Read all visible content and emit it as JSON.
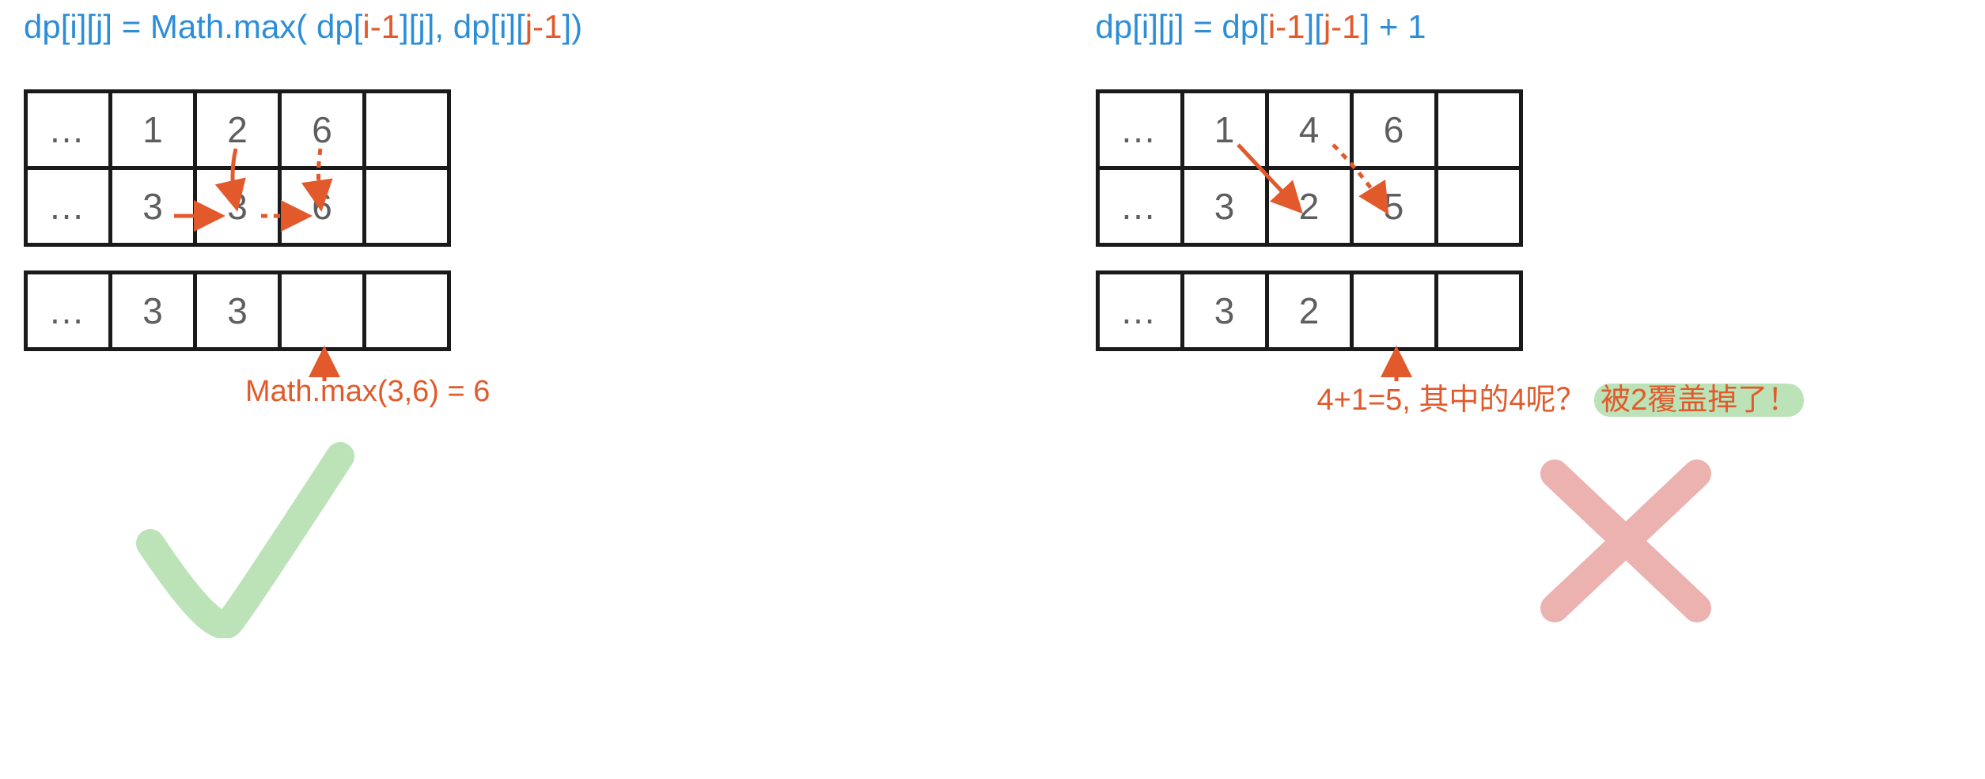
{
  "left": {
    "formula": {
      "p1": "dp[i][j] = Math.max( dp[",
      "r1": "i-1",
      "p2": "][j], dp[i][",
      "r2": "j-1",
      "p3": "])"
    },
    "grid_top": [
      [
        "…",
        "1",
        "2",
        "6",
        ""
      ],
      [
        "…",
        "3",
        "3",
        "6",
        ""
      ]
    ],
    "grid_bottom": [
      [
        "…",
        "3",
        "3",
        "",
        ""
      ]
    ],
    "explain": "Math.max(3,6) = 6",
    "mark": "check"
  },
  "right": {
    "formula": {
      "p1": "dp[i][j] = dp[",
      "r1": "i-1",
      "p2": "][",
      "r2": "j-1",
      "p3": "] + 1"
    },
    "grid_top": [
      [
        "…",
        "1",
        "4",
        "6",
        ""
      ],
      [
        "…",
        "3",
        "2",
        "5",
        ""
      ]
    ],
    "grid_bottom": [
      [
        "…",
        "3",
        "2",
        "",
        ""
      ]
    ],
    "explain_plain": "4+1=5, 其中的4呢？",
    "explain_highlight": "被2覆盖掉了！",
    "mark": "cross"
  },
  "colors": {
    "blue": "#2d8ed8",
    "red": "#e25a2b",
    "ok": "#bce3b7",
    "bad": "#ecb2af"
  }
}
